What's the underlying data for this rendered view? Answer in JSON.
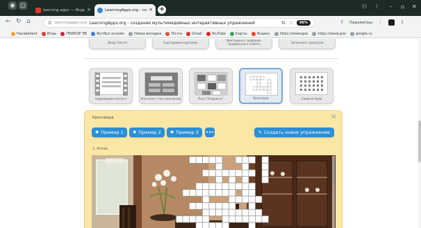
{
  "browser": {
    "tabs": [
      {
        "title": "learning apps — Яндекс",
        "active": false
      },
      {
        "title": "LearningApps.org - создание",
        "active": true
      }
    ],
    "url_host": "learningapps.org",
    "url_title": "LearningApps.org - создание мультимедийных интерактивных упражнений",
    "speed_badge": "96%",
    "toolbar_pills": [
      "Параметры"
    ]
  },
  "bookmarks": [
    {
      "label": "Hacabellent",
      "color": "#f2a33a"
    },
    {
      "label": "Игры",
      "color": "#e03a2e"
    },
    {
      "label": "ПРИКОР ЭВ",
      "color": "#d21f3c"
    },
    {
      "label": "Футбол онлайн",
      "color": "#3b7fd0"
    },
    {
      "label": "Новая вкладка",
      "color": "#9aa0a6"
    },
    {
      "label": "Почта",
      "color": "#e0552e"
    },
    {
      "label": "Gmail",
      "color": "#d93025"
    },
    {
      "label": "YouTube",
      "color": "#e62117"
    },
    {
      "label": "Карты",
      "color": "#34a853"
    },
    {
      "label": "Яндекс",
      "color": "#fc3f1d"
    },
    {
      "label": "https://www.goo",
      "color": "#9aa0a6"
    },
    {
      "label": "https://www.goo",
      "color": "#9aa0a6"
    },
    {
      "label": "google.ru",
      "color": "#9aa0a6"
    }
  ],
  "top_buttons": [
    "Ввод текста",
    "Сортировка картинок",
    "Викторина с выбором правильного ответа",
    "Заполнить пропуски"
  ],
  "templates": [
    {
      "label": "Аудио/видео контент",
      "selected": false
    },
    {
      "label": "Кто хочет стать миллионером?",
      "selected": false
    },
    {
      "label": "Пазл \"Угадай-ка\"",
      "selected": false
    },
    {
      "label": "Кроссворд",
      "selected": true
    },
    {
      "label": "Слова из букв",
      "selected": false
    }
  ],
  "panel": {
    "title": "Кроссворд",
    "close": "✕",
    "examples": [
      "Пример 1",
      "Пример 2",
      "Пример 3"
    ],
    "more": "•••",
    "create_label": "Создать новое упражнение",
    "question": "1. Котик"
  },
  "colors": {
    "accent_blue": "#2a8fd6",
    "panel_yellow": "#fbe7a5",
    "selected_border": "#7aa6d4"
  }
}
